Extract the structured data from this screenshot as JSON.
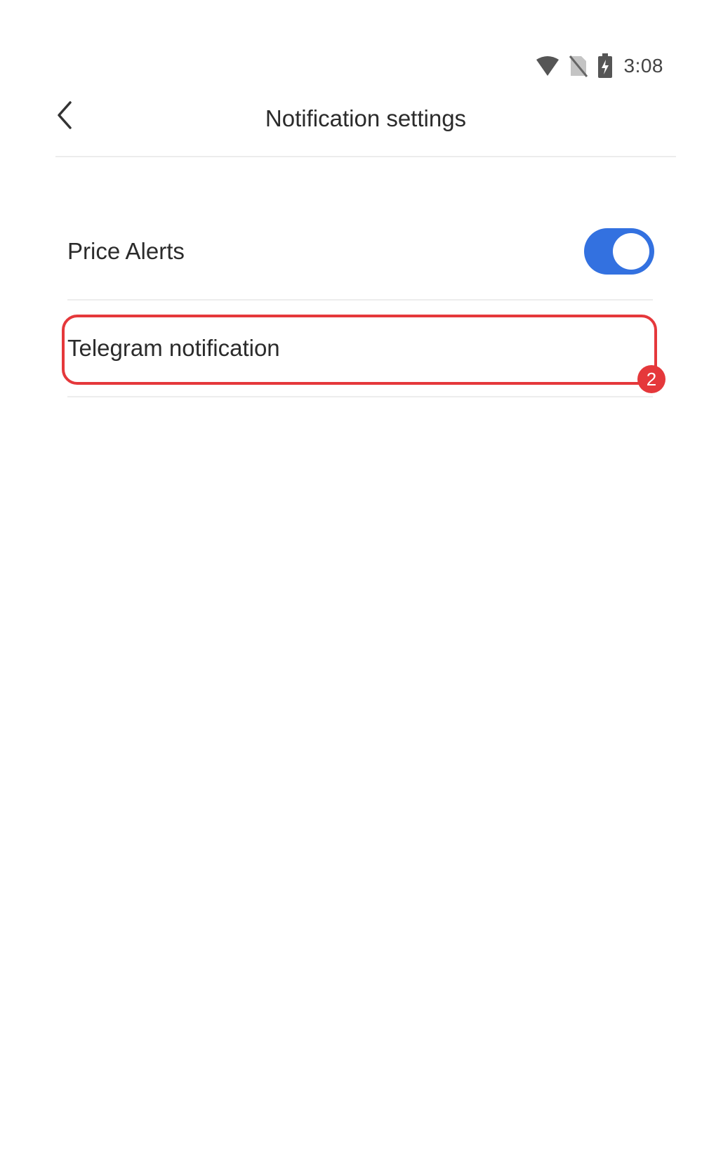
{
  "status_bar": {
    "time": "3:08",
    "icons": [
      "wifi-icon",
      "no-sim-icon",
      "battery-charging-icon"
    ]
  },
  "header": {
    "title": "Notification settings",
    "back_icon": "chevron-left-icon"
  },
  "settings": {
    "items": [
      {
        "label": "Price Alerts",
        "toggle": true
      },
      {
        "label": "Telegram notification"
      }
    ]
  },
  "annotation": {
    "badge": "2",
    "color": "#e5383b"
  },
  "colors": {
    "toggle_on": "#3371e0",
    "text": "#2b2b2b",
    "divider": "#ededed"
  }
}
